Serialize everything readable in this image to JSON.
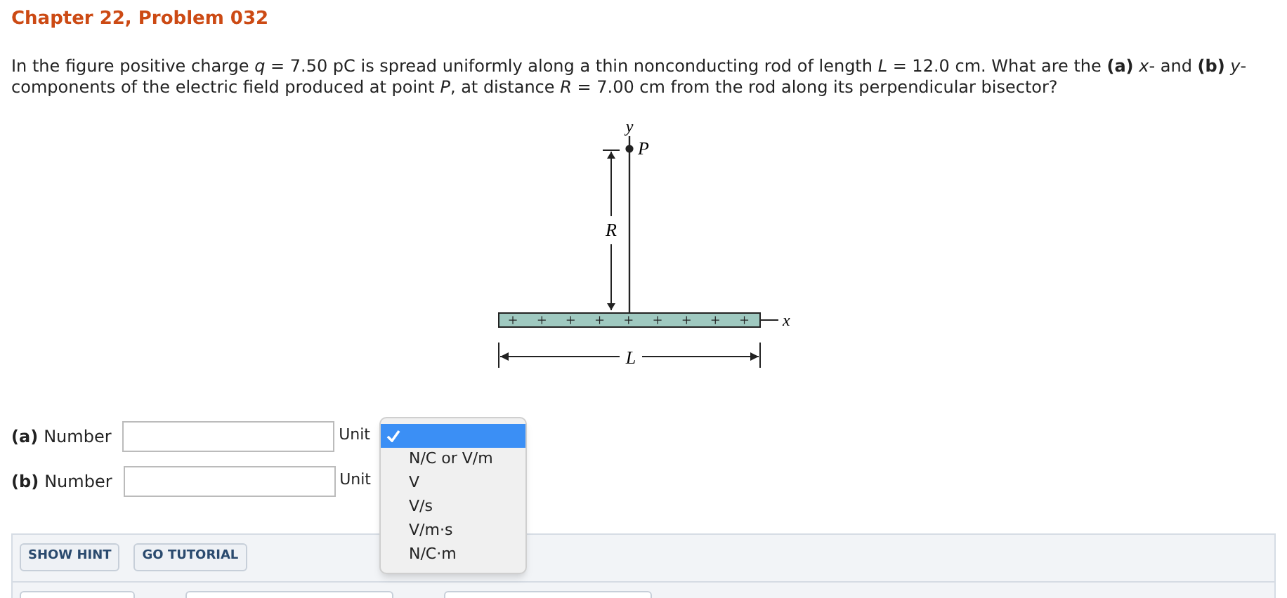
{
  "title": "Chapter 22, Problem 032",
  "question": "In the figure positive charge *q* = 7.50 pC is spread uniformly along a thin nonconducting rod of length *L* = 12.0 cm. What are the **(a)** *x*- and **(b)** *y*-components of the electric field produced at point *P*, at distance *R* = 7.00 cm from the rod along its perpendicular bisector?",
  "figure": {
    "y_axis": "y",
    "point": "P",
    "distance": "R",
    "length": "L",
    "x_axis": "x",
    "charges": [
      "+",
      "+",
      "+",
      "+",
      "+",
      "+",
      "+",
      "+",
      "+"
    ]
  },
  "answers": [
    {
      "part": "(a)",
      "label": "Number",
      "units_label": "Unit"
    },
    {
      "part": "(b)",
      "label": "Number",
      "units_label": "Unit"
    }
  ],
  "units_menu": [
    {
      "selected": true
    },
    {
      "label": "N/C or V/m",
      "selected": false
    },
    {
      "label": "V",
      "selected": false
    },
    {
      "label": "V/s",
      "selected": false
    },
    {
      "label": "V/m·s",
      "selected": false
    },
    {
      "label": "N/C·m",
      "selected": false
    }
  ],
  "buttons": [
    "SHOW HINT",
    "GO TUTORIAL"
  ]
}
